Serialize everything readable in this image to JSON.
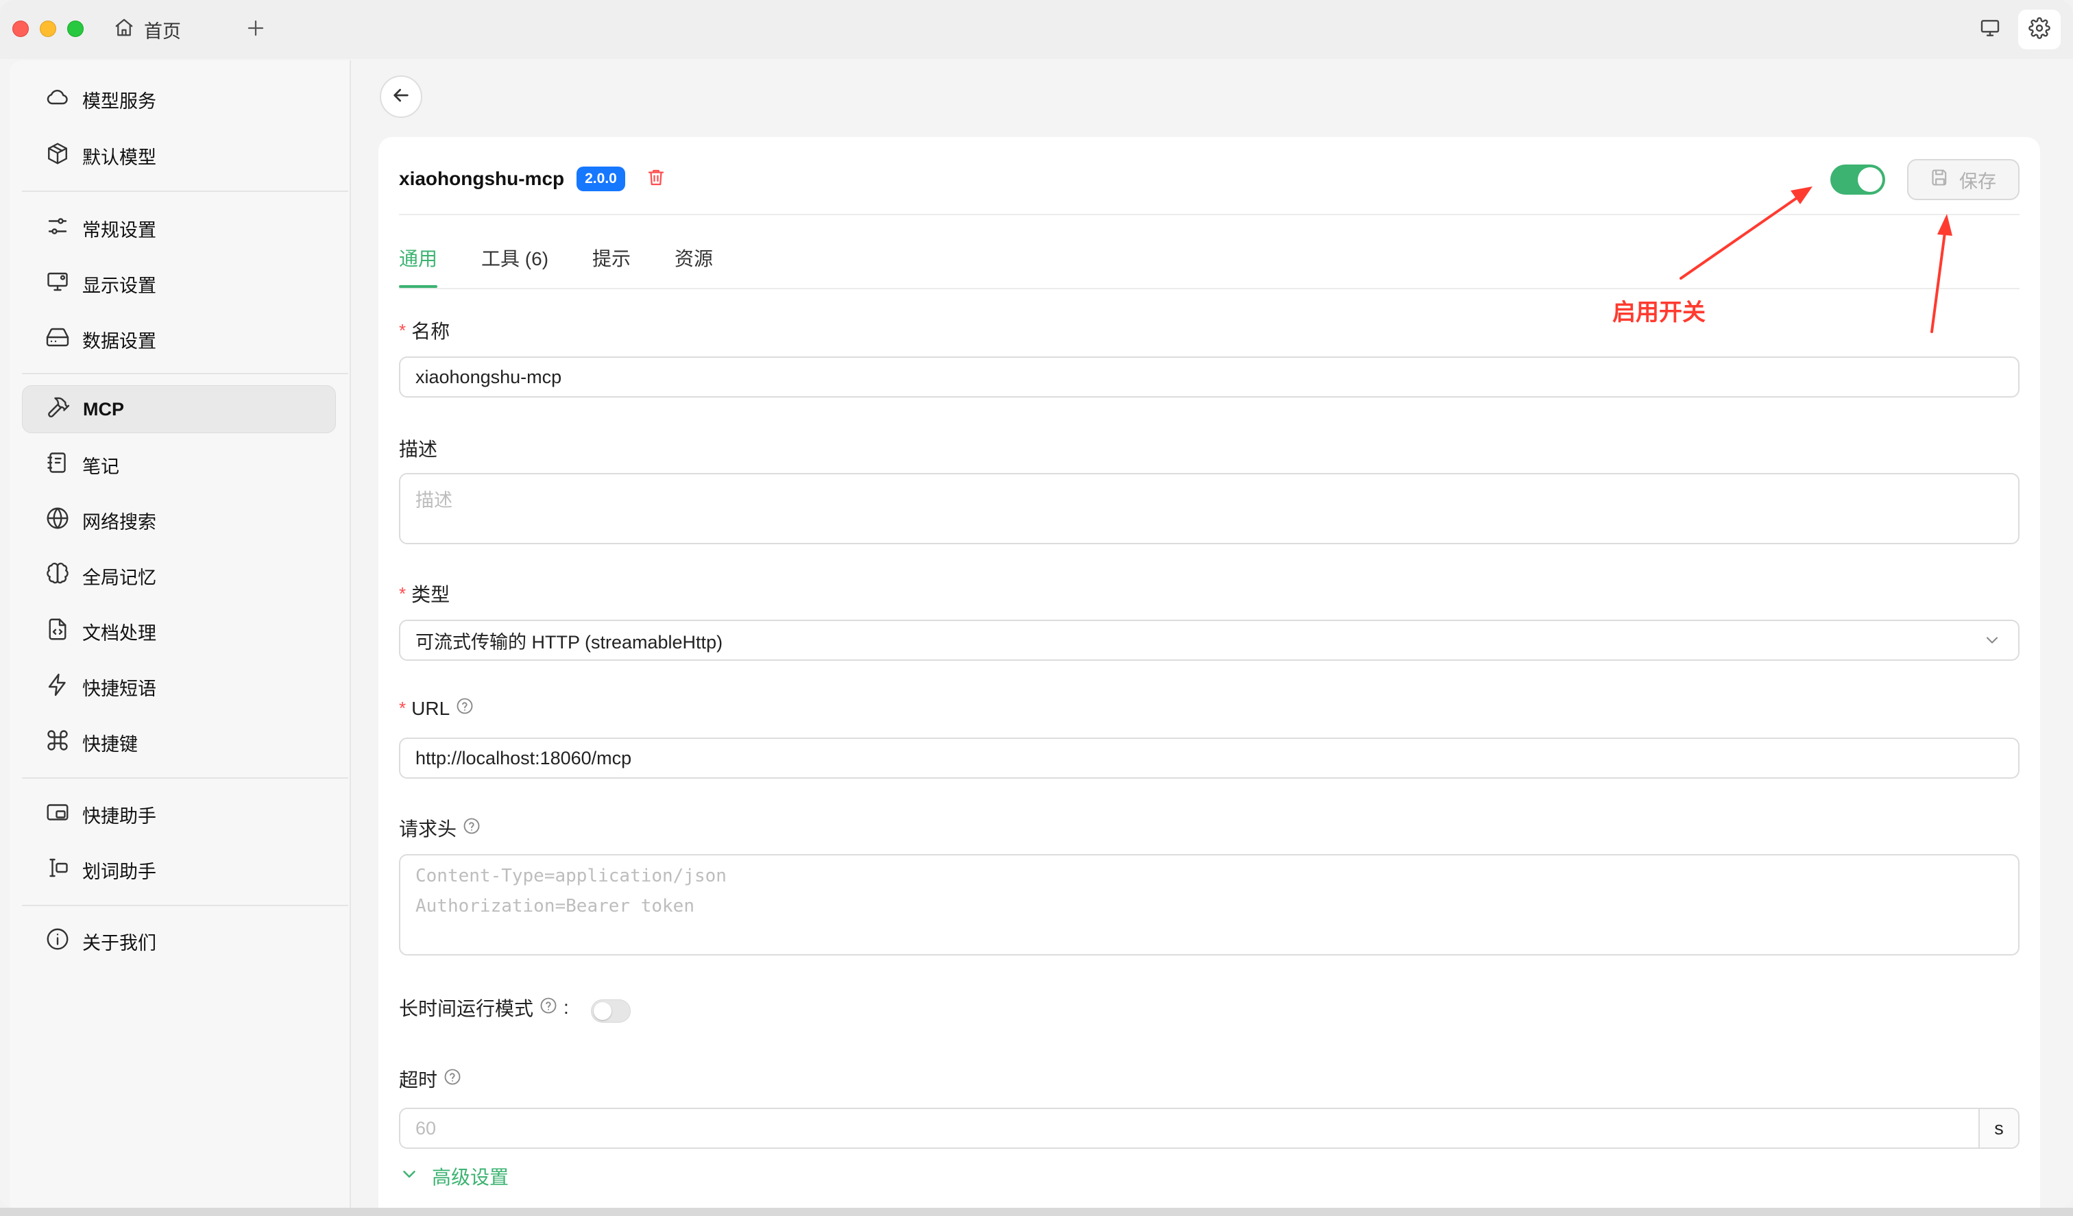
{
  "titlebar": {
    "home_tab_label": "首页",
    "home_icon": "home-icon",
    "new_tab_icon": "plus-icon",
    "right_icons": [
      "monitor-icon",
      "gear-icon"
    ]
  },
  "sidebar": {
    "items": [
      {
        "label": "模型服务",
        "icon": "cloud-icon"
      },
      {
        "label": "默认模型",
        "icon": "cube-icon"
      },
      {
        "label": "常规设置",
        "icon": "sliders-icon"
      },
      {
        "label": "显示设置",
        "icon": "display-settings-icon"
      },
      {
        "label": "数据设置",
        "icon": "hard-drive-icon"
      },
      {
        "label": "MCP",
        "icon": "hammer-icon",
        "active": true
      },
      {
        "label": "笔记",
        "icon": "notebook-icon"
      },
      {
        "label": "网络搜索",
        "icon": "globe-icon"
      },
      {
        "label": "全局记忆",
        "icon": "brain-icon"
      },
      {
        "label": "文档处理",
        "icon": "file-code-icon"
      },
      {
        "label": "快捷短语",
        "icon": "zap-icon"
      },
      {
        "label": "快捷键",
        "icon": "command-icon"
      },
      {
        "label": "快捷助手",
        "icon": "assistant-window-icon"
      },
      {
        "label": "划词助手",
        "icon": "text-select-icon"
      },
      {
        "label": "关于我们",
        "icon": "info-icon"
      }
    ]
  },
  "server": {
    "name": "xiaohongshu-mcp",
    "version": "2.0.0",
    "enabled": true,
    "save_label": "保存"
  },
  "tabs": [
    "通用",
    "工具 (6)",
    "提示",
    "资源"
  ],
  "active_tab": "通用",
  "form": {
    "name_label": "名称",
    "name_value": "xiaohongshu-mcp",
    "desc_label": "描述",
    "desc_placeholder": "描述",
    "type_label": "类型",
    "type_value": "可流式传输的 HTTP (streamableHttp)",
    "url_label": "URL",
    "url_value": "http://localhost:18060/mcp",
    "headers_label": "请求头",
    "headers_placeholder_line1": "Content-Type=application/json",
    "headers_placeholder_line2": "Authorization=Bearer token",
    "long_running_label": "长时间运行模式",
    "long_running_colon": ":",
    "long_running_enabled": false,
    "timeout_label": "超时",
    "timeout_placeholder": "60",
    "timeout_unit": "s",
    "advanced_label": "高级设置"
  },
  "annotation": {
    "text": "启用开关",
    "color": "#ff3b30"
  },
  "colors": {
    "accent": "#3cb371",
    "badge": "#1677ff",
    "danger": "#ff4d4f"
  }
}
